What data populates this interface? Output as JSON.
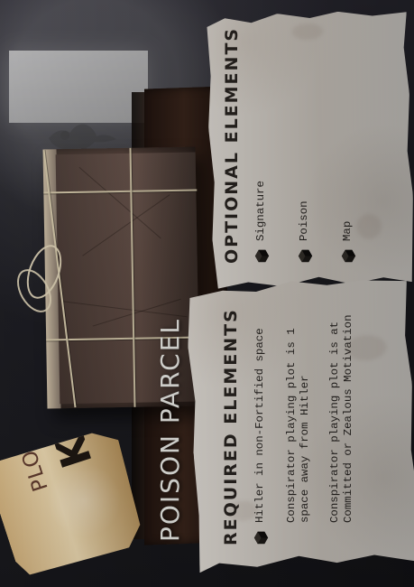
{
  "card": {
    "title": "POISON PARCEL",
    "plot_tag": {
      "label": "PLOT",
      "letter": "K"
    },
    "optional_elements": {
      "heading": "OPTIONAL ELEMENTS",
      "items": [
        {
          "label": "Signature",
          "icon": "cube-icon"
        },
        {
          "label": "Poison",
          "icon": "cube-icon"
        },
        {
          "label": "Map",
          "icon": "cube-icon"
        }
      ]
    },
    "required_elements": {
      "heading": "REQUIRED ELEMENTS",
      "items": [
        {
          "label": "Hitler in non-Fortified space",
          "icon": "cube-icon"
        },
        {
          "label": "Conspirator playing plot is 1 space away from Hitler",
          "icon": "cube-icon"
        },
        {
          "label": "Conspirator playing plot is at Committed or Zealous Motivation",
          "icon": "cube-icon"
        }
      ]
    }
  },
  "colors": {
    "background": "#1f1f25",
    "paper": "#ece6dd",
    "title_text": "#f7f7f2",
    "tag": "#d7bd8a"
  }
}
